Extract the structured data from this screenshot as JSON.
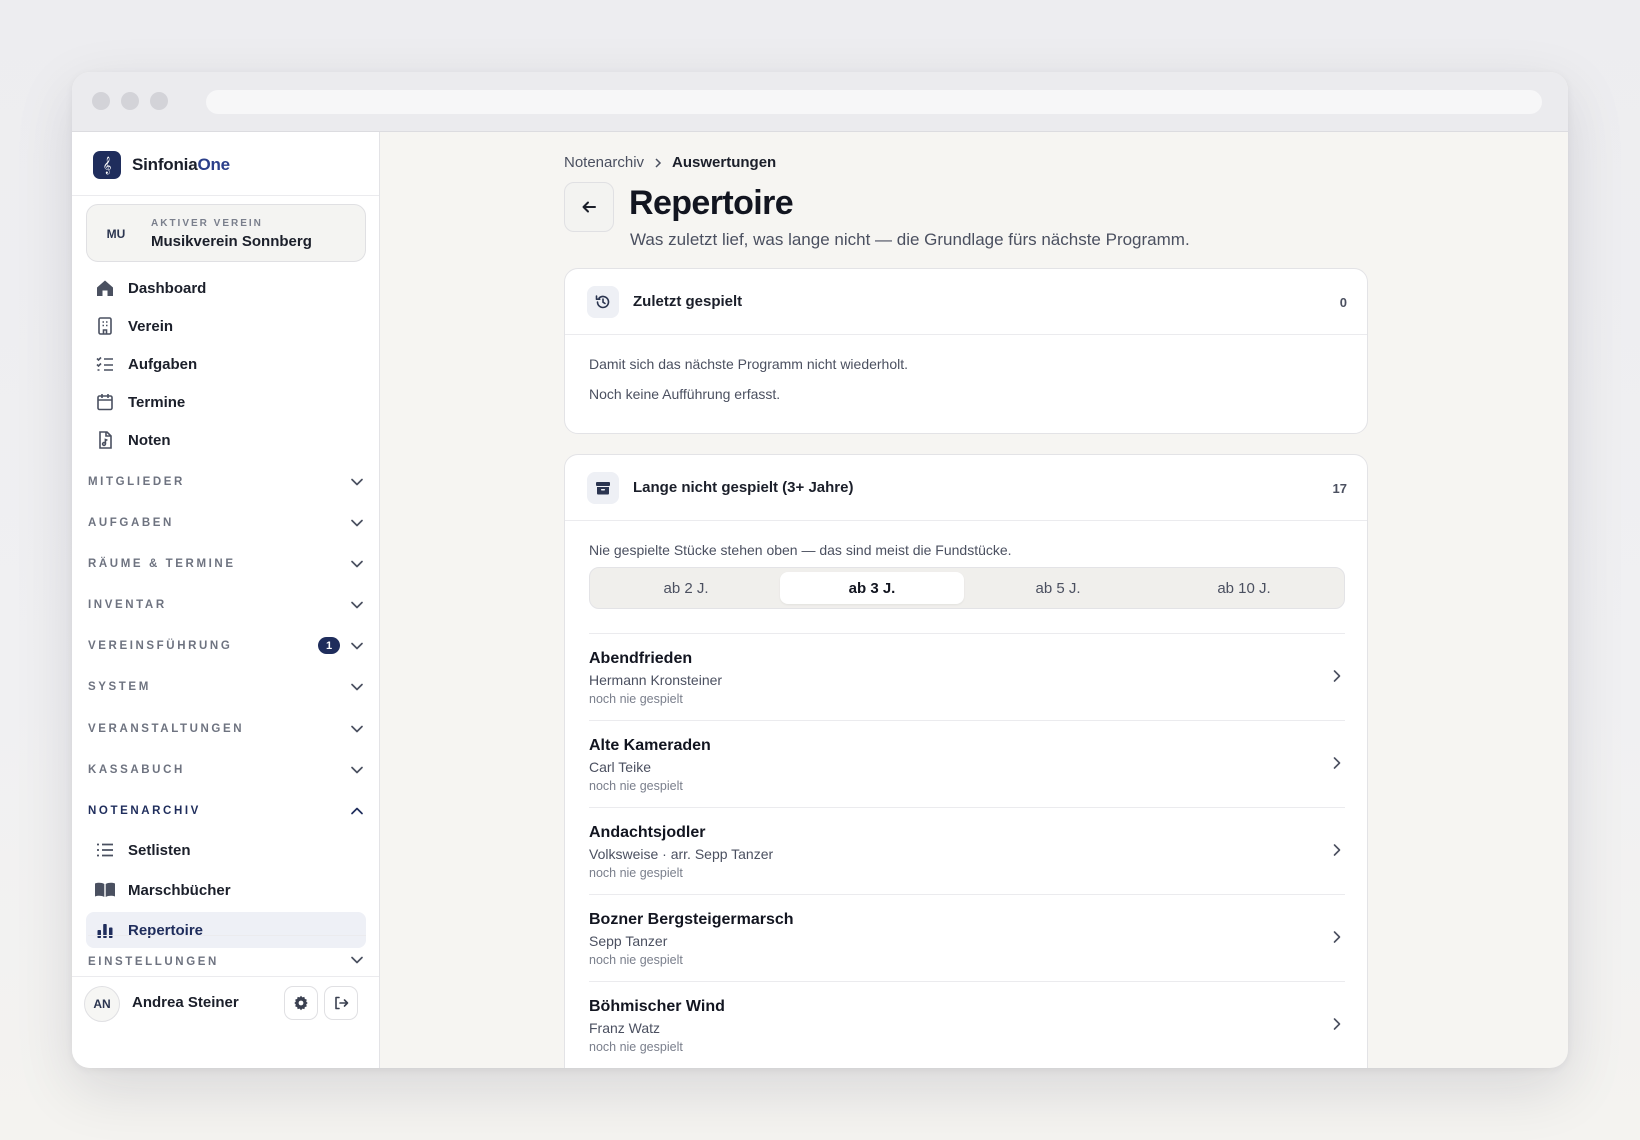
{
  "sidebar": {
    "brand": {
      "name_main": "Sinfonia",
      "name_accent": "One"
    },
    "verein": {
      "avatar": "MU",
      "label": "AKTIVER VEREIN",
      "name": "Musikverein Sonnberg"
    },
    "nav": [
      {
        "label": "Dashboard",
        "icon": "home-icon"
      },
      {
        "label": "Verein",
        "icon": "building-icon"
      },
      {
        "label": "Aufgaben",
        "icon": "checklist-icon"
      },
      {
        "label": "Termine",
        "icon": "calendar-icon"
      },
      {
        "label": "Noten",
        "icon": "music-file-icon"
      }
    ],
    "sections": [
      {
        "label": "MITGLIEDER"
      },
      {
        "label": "AUFGABEN"
      },
      {
        "label": "RÄUME & TERMINE"
      },
      {
        "label": "INVENTAR"
      },
      {
        "label": "VEREINSFÜHRUNG",
        "badge": "1"
      },
      {
        "label": "SYSTEM"
      },
      {
        "label": "VERANSTALTUNGEN"
      },
      {
        "label": "KASSABUCH"
      },
      {
        "label": "NOTENARCHIV"
      }
    ],
    "notenarchiv_items": [
      {
        "label": "Setlisten",
        "icon": "list-icon"
      },
      {
        "label": "Marschbücher",
        "icon": "book-icon"
      },
      {
        "label": "Repertoire",
        "icon": "bar-chart-icon"
      }
    ],
    "settings_section": {
      "label": "EINSTELLUNGEN"
    },
    "user": {
      "avatar": "AN",
      "name": "Andrea Steiner"
    }
  },
  "main": {
    "breadcrumb": [
      "Notenarchiv",
      "Auswertungen"
    ],
    "title": "Repertoire",
    "subtitle": "Was zuletzt lief, was lange nicht — die Grundlage fürs nächste Programm.",
    "recent": {
      "title": "Zuletzt gespielt",
      "count": "0",
      "description": "Damit sich das nächste Programm nicht wiederholt.",
      "empty": "Noch keine Aufführung erfasst."
    },
    "long_unplayed": {
      "title": "Lange nicht gespielt (3+ Jahre)",
      "count": "17",
      "description": "Nie gespielte Stücke stehen oben — das sind meist die Fundstücke.",
      "filters": [
        "ab 2 J.",
        "ab 3 J.",
        "ab 5 J.",
        "ab 10 J."
      ],
      "active_filter": "ab 3 J.",
      "items": [
        {
          "title": "Abendfrieden",
          "composer": "Hermann Kronsteiner",
          "status": "noch nie gespielt"
        },
        {
          "title": "Alte Kameraden",
          "composer": "Carl Teike",
          "status": "noch nie gespielt"
        },
        {
          "title": "Andachtsjodler",
          "composer": "Volksweise · arr. Sepp Tanzer",
          "status": "noch nie gespielt"
        },
        {
          "title": "Bozner Bergsteigermarsch",
          "composer": "Sepp Tanzer",
          "status": "noch nie gespielt"
        },
        {
          "title": "Böhmischer Wind",
          "composer": "Franz Watz",
          "status": "noch nie gespielt"
        }
      ]
    }
  },
  "colors": {
    "brand": "#1f2d5c",
    "active_bg": "#eef0f6"
  }
}
